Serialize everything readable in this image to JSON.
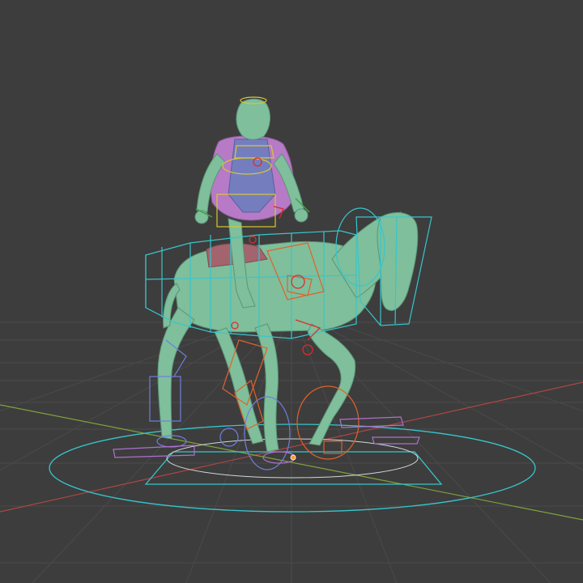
{
  "viewport": {
    "background_color": "#3d3d3d",
    "grid_color": "#4a4a4a",
    "x_axis_color": "#b04545",
    "y_axis_color": "#7fa33b"
  },
  "scene": {
    "model_name": "horse-and-rider",
    "horse_color": "#7fbf9b",
    "rider_body_color": "#7fbf9b",
    "rider_torso_color": "#b77ac6",
    "saddle_color": "#a3646d",
    "rig_colors": {
      "cyan": "#37c6cc",
      "orange": "#e0622a",
      "yellow": "#d8c733",
      "blue": "#6f7fe0",
      "purple": "#b070d0",
      "red": "#e02a2a",
      "green": "#3fa33f"
    }
  }
}
